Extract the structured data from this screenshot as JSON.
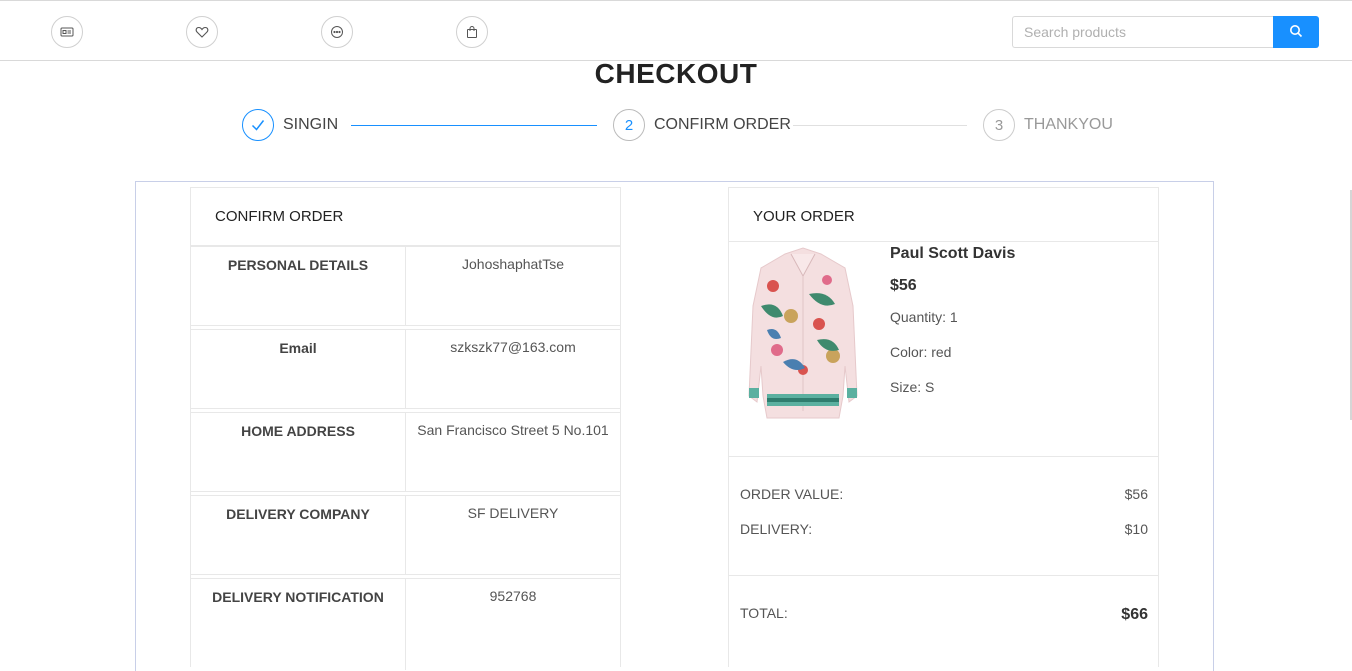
{
  "search": {
    "placeholder": "Search products"
  },
  "nav_icons": [
    "id-card-icon",
    "heart-icon",
    "message-icon",
    "shopping-bag-icon"
  ],
  "checkout": {
    "title": "CHECKOUT",
    "steps": [
      {
        "num": "1",
        "label": "SINGIN",
        "status": "done"
      },
      {
        "num": "2",
        "label": "CONFIRM ORDER",
        "status": "active"
      },
      {
        "num": "3",
        "label": "THANKYOU",
        "status": "wait"
      }
    ]
  },
  "confirm": {
    "heading": "CONFIRM ORDER",
    "rows": [
      {
        "label": "PERSONAL DETAILS",
        "value": "JohoshaphatTse"
      },
      {
        "label": "Email",
        "value": "szkszk77@163.com"
      },
      {
        "label": "HOME ADDRESS",
        "value": "San Francisco Street 5 No.101"
      },
      {
        "label": "DELIVERY COMPANY",
        "value": "SF DELIVERY"
      },
      {
        "label": "DELIVERY NOTIFICATION",
        "value": "952768"
      }
    ]
  },
  "order": {
    "heading": "YOUR ORDER",
    "product": {
      "name": "Paul Scott Davis",
      "price": "$56",
      "quantity": "Quantity: 1",
      "color": "Color: red",
      "size": "Size: S"
    },
    "order_value_label": "ORDER VALUE:",
    "order_value": "$56",
    "delivery_label": "DELIVERY:",
    "delivery": "$10",
    "total_label": "TOTAL:",
    "total": "$66"
  },
  "colors": {
    "accent": "#1890ff",
    "border": "#e8e8e8"
  }
}
